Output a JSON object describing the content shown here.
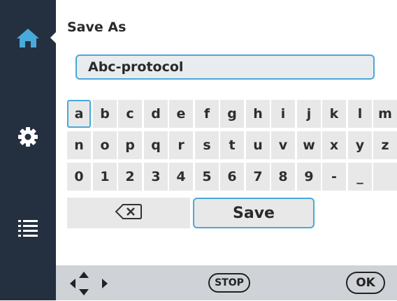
{
  "sidebar": {
    "items": [
      {
        "icon": "home-icon",
        "active": true
      },
      {
        "icon": "gear-icon",
        "active": false
      },
      {
        "icon": "list-icon",
        "active": false
      }
    ],
    "active_color": "#49a9d8"
  },
  "dialog": {
    "title": "Save As",
    "name_value": "Abc-protocol"
  },
  "keyboard": {
    "rows": [
      [
        "a",
        "b",
        "c",
        "d",
        "e",
        "f",
        "g",
        "h",
        "i",
        "j",
        "k",
        "l",
        "m"
      ],
      [
        "n",
        "o",
        "p",
        "q",
        "r",
        "s",
        "t",
        "u",
        "v",
        "w",
        "x",
        "y",
        "z"
      ],
      [
        "0",
        "1",
        "2",
        "3",
        "4",
        "5",
        "6",
        "7",
        "8",
        "9",
        "-",
        "_",
        ""
      ]
    ],
    "selected_key": "a",
    "backspace_icon": "backspace-icon",
    "save_label": "Save"
  },
  "bottombar": {
    "nav_icon": "four-way-arrows-icon",
    "stop_label": "STOP",
    "ok_label": "OK"
  },
  "colors": {
    "sidebar_bg": "#243040",
    "accent": "#49a9d8",
    "key_bg": "#e8e8e8",
    "bottom_bg": "#cfd3d7"
  }
}
